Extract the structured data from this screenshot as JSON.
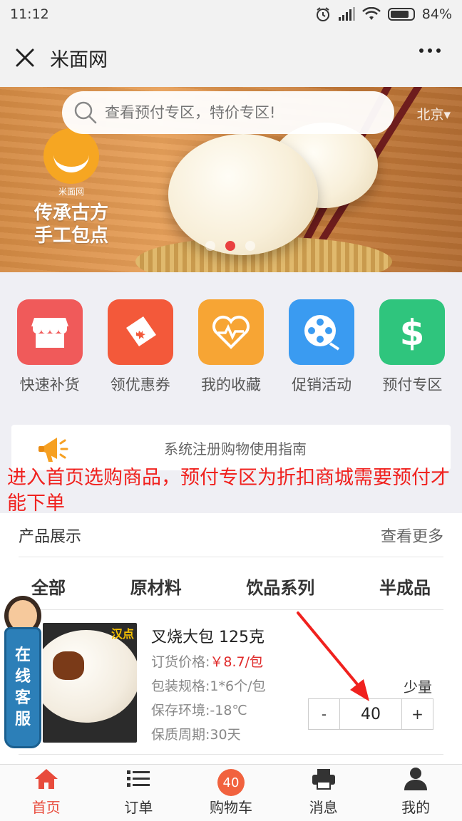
{
  "status_bar": {
    "time": "11:12",
    "battery_percent": "84%",
    "battery_level": 0.84
  },
  "header": {
    "title": "米面网",
    "close_icon": "close-icon",
    "more_icon": "more-icon"
  },
  "banner": {
    "search_placeholder": "查看预付专区，特价专区!",
    "city": "北京",
    "logo_name": "米面网",
    "slogan_line1": "传承古方",
    "slogan_line2": "手工包点",
    "active_slide": 2,
    "total_slides": 3
  },
  "shortcuts": [
    {
      "label": "快速补货",
      "icon": "store-icon",
      "color": "#f05a5a"
    },
    {
      "label": "领优惠券",
      "icon": "ticket-icon",
      "color": "#f3593a"
    },
    {
      "label": "我的收藏",
      "icon": "heart-pulse-icon",
      "color": "#f7a534"
    },
    {
      "label": "促销活动",
      "icon": "film-reel-icon",
      "color": "#3a9bf1"
    },
    {
      "label": "预付专区",
      "icon": "dollar-icon",
      "color": "#2fc57d"
    }
  ],
  "notice": {
    "text": "系统注册购物使用指南",
    "icon": "megaphone-icon"
  },
  "annotation": {
    "text": "进入首页选购商品，预付专区为折扣商城需要预付才能下单"
  },
  "products": {
    "section_title": "产品展示",
    "more_label": "查看更多",
    "tabs": [
      "全部",
      "原材料",
      "饮品系列",
      "半成品"
    ],
    "items": [
      {
        "tag": "汉点",
        "name": "叉烧大包 125克",
        "price_label": "订货价格:",
        "price": "￥8.7/包",
        "spec": "包装规格:1*6个/包",
        "storage": "保存环境:-18℃",
        "shelf_life": "保质周期:30天",
        "qty_label": "少量",
        "qty": "40",
        "minus": "-",
        "plus": "+"
      }
    ]
  },
  "service": {
    "label": "在线客服",
    "icon": "agent-icon"
  },
  "bottom_nav": [
    {
      "label": "首页",
      "icon": "home-icon",
      "active": true
    },
    {
      "label": "订单",
      "icon": "list-icon",
      "active": false
    },
    {
      "label": "购物车",
      "icon": "cart-icon",
      "badge": "40",
      "active": false
    },
    {
      "label": "消息",
      "icon": "printer-icon",
      "active": false
    },
    {
      "label": "我的",
      "icon": "user-icon",
      "active": false
    }
  ],
  "colors": {
    "accent": "#e84b3c",
    "price": "#e02a2a",
    "annotation": "#f0211e"
  }
}
